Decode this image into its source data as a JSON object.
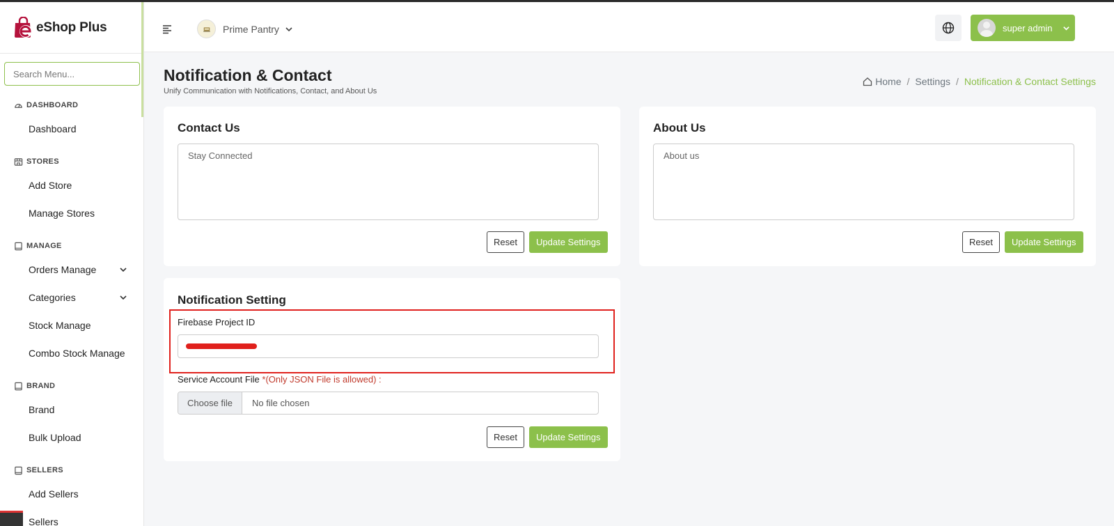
{
  "app": {
    "name": "eShop Plus"
  },
  "sidebar": {
    "search_placeholder": "Search Menu...",
    "sections": [
      {
        "title": "DASHBOARD",
        "icon": "gauge-icon",
        "items": [
          {
            "label": "Dashboard"
          }
        ]
      },
      {
        "title": "STORES",
        "icon": "store-icon",
        "items": [
          {
            "label": "Add Store"
          },
          {
            "label": "Manage Stores"
          }
        ]
      },
      {
        "title": "MANAGE",
        "icon": "book-icon",
        "items": [
          {
            "label": "Orders Manage",
            "expandable": true
          },
          {
            "label": "Categories",
            "expandable": true
          },
          {
            "label": "Stock Manage"
          },
          {
            "label": "Combo Stock Manage"
          }
        ]
      },
      {
        "title": "BRAND",
        "icon": "book-icon",
        "items": [
          {
            "label": "Brand"
          },
          {
            "label": "Bulk Upload"
          }
        ]
      },
      {
        "title": "SELLERS",
        "icon": "book-icon",
        "items": [
          {
            "label": "Add Sellers"
          },
          {
            "label": "Sellers"
          }
        ]
      }
    ]
  },
  "header": {
    "store_name": "Prime Pantry",
    "user_name": "super admin"
  },
  "page": {
    "title": "Notification & Contact",
    "subtitle": "Unify Communication with Notifications, Contact, and About Us",
    "breadcrumb": {
      "home": "Home",
      "settings": "Settings",
      "current": "Notification & Contact Settings"
    }
  },
  "contact": {
    "title": "Contact Us",
    "placeholder": "Stay Connected",
    "reset_label": "Reset",
    "update_label": "Update Settings"
  },
  "about": {
    "title": "About Us",
    "placeholder": "About us",
    "reset_label": "Reset",
    "update_label": "Update Settings"
  },
  "notification": {
    "title": "Notification Setting",
    "firebase_label": "Firebase Project ID",
    "service_label": "Service Account File",
    "service_note": "*(Only JSON File is allowed) :",
    "choose_file": "Choose file",
    "no_file": "No file chosen",
    "reset_label": "Reset",
    "update_label": "Update Settings"
  },
  "colors": {
    "accent": "#8cc04b",
    "highlight": "#e0201c",
    "brand": "#b5123c"
  }
}
